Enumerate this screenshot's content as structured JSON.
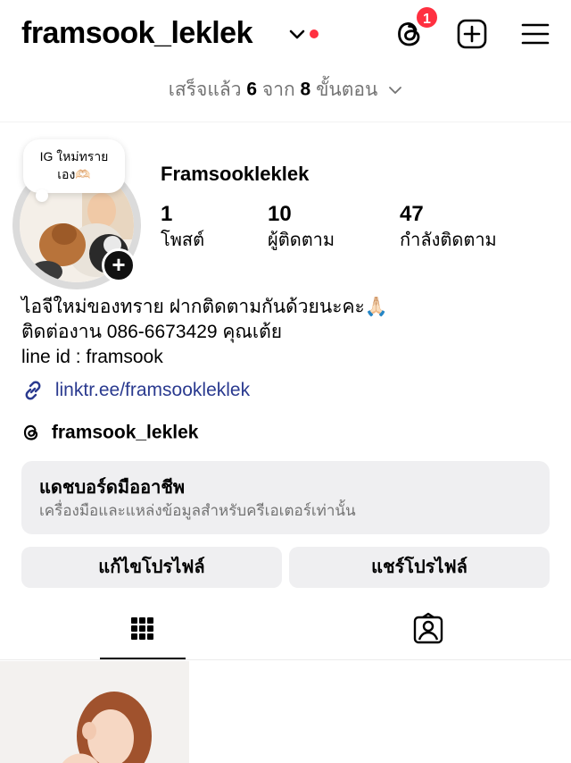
{
  "header": {
    "username": "framsook_leklek",
    "notification_count": "1",
    "colors": {
      "badge": "#ff3040",
      "unread_dot": "#ff3040"
    }
  },
  "progress": {
    "prefix": "เสร็จแล้ว",
    "done": "6",
    "middle": "จาก",
    "total": "8",
    "suffix": "ขั้นตอน"
  },
  "profile": {
    "note": [
      "IG ใหม่ทราย",
      "เอง🫶🏻"
    ],
    "display_name": "Framsookleklek",
    "stats": [
      {
        "value": "1",
        "label": "โพสต์"
      },
      {
        "value": "10",
        "label": "ผู้ติดตาม"
      },
      {
        "value": "47",
        "label": "กำลังติดตาม"
      }
    ],
    "bio_lines": [
      "ไอจีใหม่ของทราย ฝากติดตามกันด้วยนะคะ🙏🏻",
      "ติดต่องาน 086-6673429 คุณเต้ย",
      "line id : framsook"
    ],
    "link": "linktr.ee/framsookleklek",
    "threads_handle": "framsook_leklek",
    "link_color": "#2a3a8f"
  },
  "dashboard": {
    "title": "แดชบอร์ดมืออาชีพ",
    "subtitle": "เครื่องมือและแหล่งข้อมูลสำหรับครีเอเตอร์เท่านั้น"
  },
  "actions": {
    "edit_label": "แก้ไขโปรไฟล์",
    "share_label": "แชร์โปรไฟล์"
  },
  "tabs": [
    {
      "icon": "grid-icon",
      "active": true
    },
    {
      "icon": "tagged-icon",
      "active": false
    }
  ]
}
